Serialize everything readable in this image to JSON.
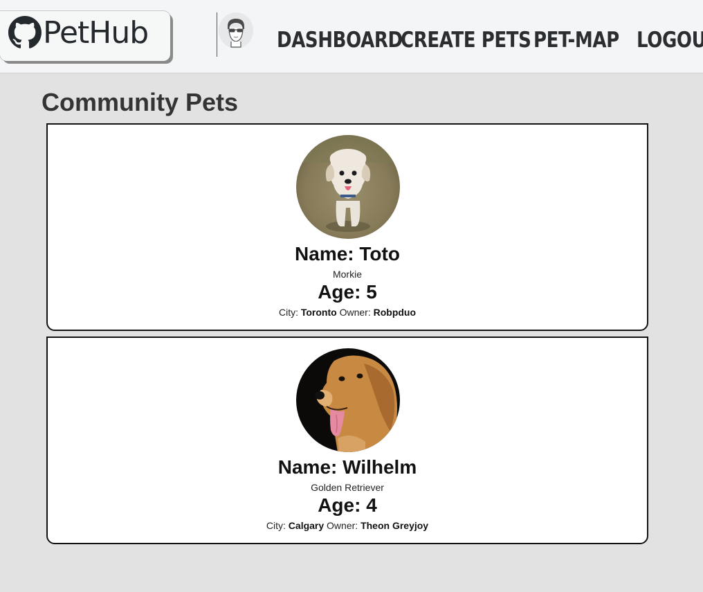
{
  "header": {
    "logo_text": "PetHub",
    "logo_icon": "github-octocat-icon",
    "avatar_icon": "user-sunglasses-avatar-icon",
    "nav": [
      {
        "label": "DASHBOARD"
      },
      {
        "label": "CREATE PETS"
      },
      {
        "label": "PET-MAP"
      },
      {
        "label": "LOGOUT"
      }
    ]
  },
  "page": {
    "title": "Community Pets"
  },
  "pets": [
    {
      "name_label": "Name: Toto",
      "breed": "Morkie",
      "age_label": "Age: 5",
      "city_label": "City:",
      "city": "Toronto",
      "owner_label": "Owner:",
      "owner": "Robpduo",
      "photo": "small-fluffy-dog-on-grass-photo"
    },
    {
      "name_label": "Name: Wilhelm",
      "breed": "Golden Retriever",
      "age_label": "Age: 4",
      "city_label": "City:",
      "city": "Calgary",
      "owner_label": "Owner:",
      "owner": "Theon Greyjoy",
      "photo": "golden-retriever-portrait-photo"
    }
  ],
  "colors": {
    "page_background": "#e2e2e2",
    "header_background": "#f3f5f6",
    "card_background": "#ffffff",
    "card_border": "#111111",
    "nav_text": "#2b2e31"
  }
}
